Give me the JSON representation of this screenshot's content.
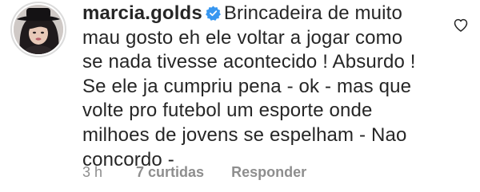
{
  "comment": {
    "username": "marcia.golds",
    "verified": true,
    "text": "Brincadeira de muito mau gosto eh ele voltar a jogar como se nada tivesse acontecido ! Absurdo ! Se ele ja cumpriu pena - ok - mas que volte pro futebol um esporte onde milhoes de jovens se espelham - Nao concordo -",
    "time": "3 h",
    "likes": "7 curtidas",
    "reply_label": "Responder"
  },
  "icons": {
    "verified": "verified-badge-icon",
    "like": "heart-outline-icon"
  },
  "colors": {
    "text": "#262626",
    "secondary": "#8e8e8e",
    "verified": "#3897f0"
  }
}
